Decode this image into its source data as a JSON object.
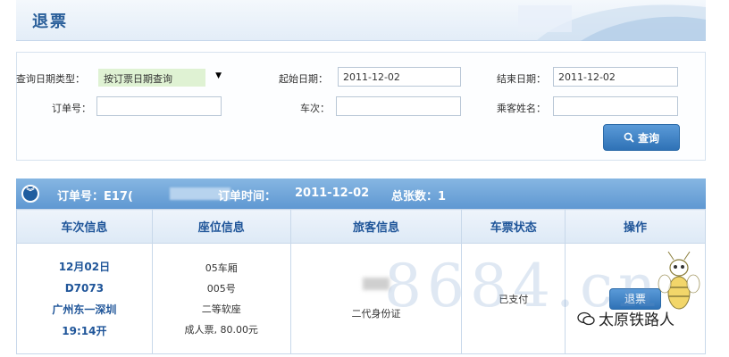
{
  "header": {
    "title": "退票"
  },
  "query": {
    "date_type_label": "查询日期类型：",
    "date_type_value": "按订票日期查询",
    "start_label": "起始日期：",
    "start_value": "2011-12-02",
    "end_label": "结束日期：",
    "end_value": "2011-12-02",
    "order_label": "订单号：",
    "order_value": "",
    "train_label": "车次：",
    "train_value": "",
    "passenger_label": "乘客姓名：",
    "passenger_value": "",
    "search_button": "查询"
  },
  "result_bar": {
    "order_label": "订单号：E17(",
    "time_label": "订单时间：",
    "time_value": "2011-12-02",
    "count_label": "总张数：1"
  },
  "table": {
    "headers": [
      "车次信息",
      "座位信息",
      "旅客信息",
      "车票状态",
      "操作"
    ],
    "row": {
      "train": {
        "date": "12月02日",
        "number": "D7073",
        "route": "广州东一深圳",
        "depart": "19:14开"
      },
      "seat": {
        "car": "05车厢",
        "seat": "005号",
        "class": "二等软座",
        "ticket": "成人票, 80.00元"
      },
      "passenger": {
        "id_type": "二代身份证"
      },
      "status": "已支付",
      "action_button": "退票"
    }
  },
  "watermark": "8684.cn",
  "wechat_account": "太原铁路人",
  "colors": {
    "primary": "#2f72b6",
    "header_text": "#1f5599",
    "bar": "#6fa6da"
  }
}
